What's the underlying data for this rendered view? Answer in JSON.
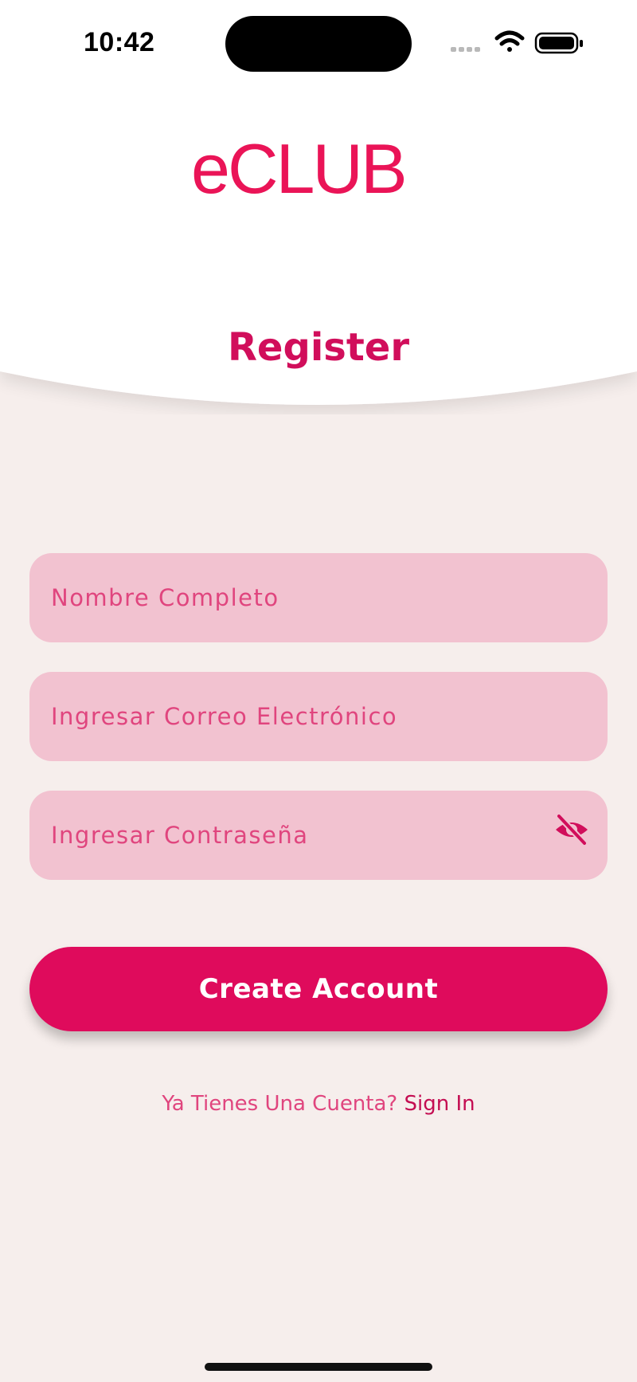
{
  "status_bar": {
    "time": "10:42",
    "icons": [
      "cellular-signal-icon",
      "wifi-icon",
      "battery-icon"
    ]
  },
  "brand": {
    "logo_text": "eCLUB",
    "logo_color": "#ea1457"
  },
  "page": {
    "title": "Register"
  },
  "form": {
    "full_name": {
      "placeholder": "Nombre Completo",
      "value": ""
    },
    "email": {
      "placeholder": "Ingresar Correo Electrónico",
      "value": ""
    },
    "password": {
      "placeholder": "Ingresar Contraseña",
      "value": "",
      "toggle_icon": "eye-off-icon"
    },
    "submit_label": "Create Account"
  },
  "footer": {
    "prompt": "Ya Tienes Una Cuenta?",
    "link_label": "Sign In"
  },
  "colors": {
    "accent": "#df0b5c",
    "field_bg": "#f2c2d0",
    "page_bg": "#f6eeec",
    "placeholder": "#e0457e"
  }
}
